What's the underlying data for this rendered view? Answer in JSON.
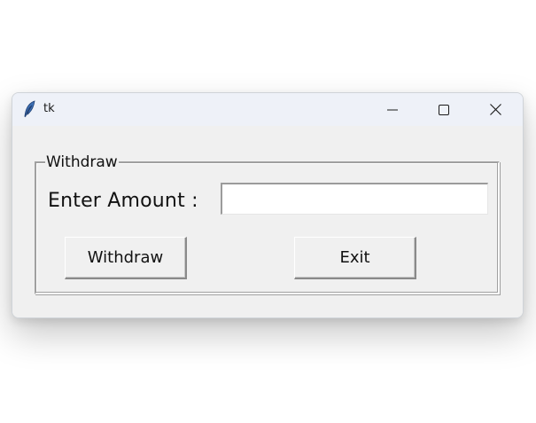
{
  "window": {
    "title": "tk",
    "controls": {
      "minimize_icon": "minimize-icon",
      "maximize_icon": "maximize-icon",
      "close_icon": "close-icon"
    },
    "app_icon": "feather-icon"
  },
  "form": {
    "group_label": "Withdraw",
    "amount_label": "Enter Amount :",
    "amount_value": "",
    "withdraw_label": "Withdraw",
    "exit_label": "Exit"
  },
  "colors": {
    "window_bg": "#f0f0f0",
    "titlebar_bg": "#eef1f8",
    "entry_bg": "#ffffff"
  }
}
